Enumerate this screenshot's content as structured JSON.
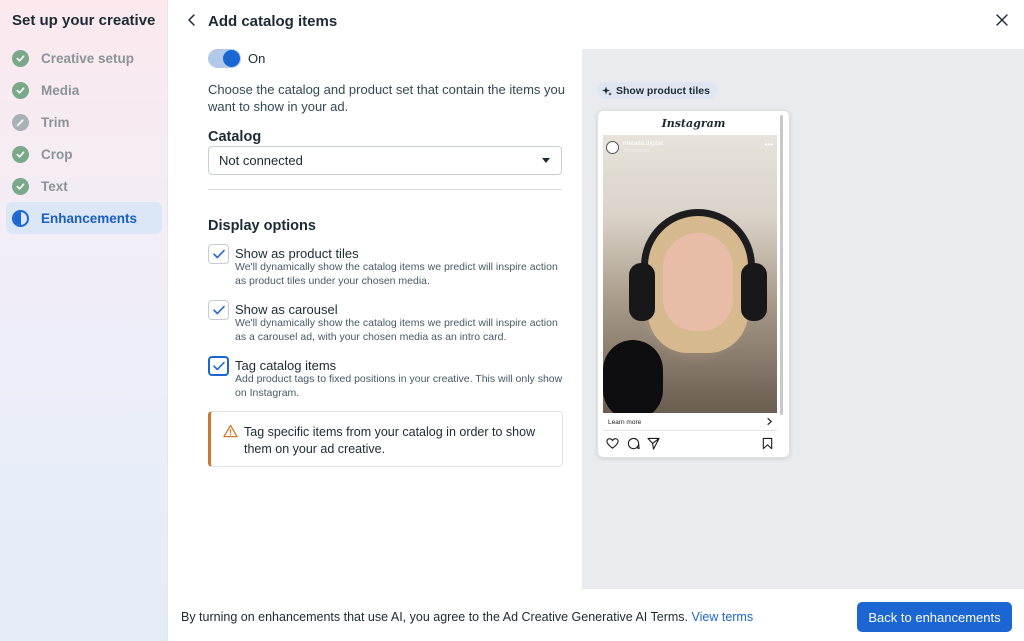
{
  "sidebar": {
    "title": "Set up your creative",
    "steps": [
      {
        "label": "Creative setup",
        "state": "done"
      },
      {
        "label": "Media",
        "state": "done"
      },
      {
        "label": "Trim",
        "state": "disabled"
      },
      {
        "label": "Crop",
        "state": "done"
      },
      {
        "label": "Text",
        "state": "done"
      },
      {
        "label": "Enhancements",
        "state": "active"
      }
    ]
  },
  "header": {
    "title": "Add catalog items"
  },
  "toggle": {
    "label": "On",
    "checked": true
  },
  "description": "Choose the catalog and product set that contain the items you want to show in your ad.",
  "catalog": {
    "label": "Catalog",
    "value": "Not connected"
  },
  "display_options": {
    "title": "Display options",
    "options": [
      {
        "title": "Show as product tiles",
        "description": "We'll dynamically show the catalog items we predict will inspire action as product tiles under your chosen media.",
        "checked": true
      },
      {
        "title": "Show as carousel",
        "description": "We'll dynamically show the catalog items we predict will inspire action as a carousel ad, with your chosen media as an intro card.",
        "checked": true
      },
      {
        "title": "Tag catalog items",
        "description": "Add product tags to fixed positions in your creative. This will only show on Instagram.",
        "checked": true
      }
    ]
  },
  "warning": {
    "text": "Tag specific items from your catalog in order to show them on your ad creative."
  },
  "preview": {
    "pill_label": "Show product tiles",
    "platform": "Instagram",
    "account_name": "metalla.digital",
    "sponsored": "Sponsored",
    "cta": "Learn more"
  },
  "footer": {
    "text": "By turning on enhancements that use AI, you agree to the Ad Creative Generative AI Terms.",
    "link": "View terms",
    "button": "Back to enhancements"
  },
  "colors": {
    "accent": "#1b66d2",
    "done": "#7aa88a",
    "warning_border": "#c77b2a"
  }
}
